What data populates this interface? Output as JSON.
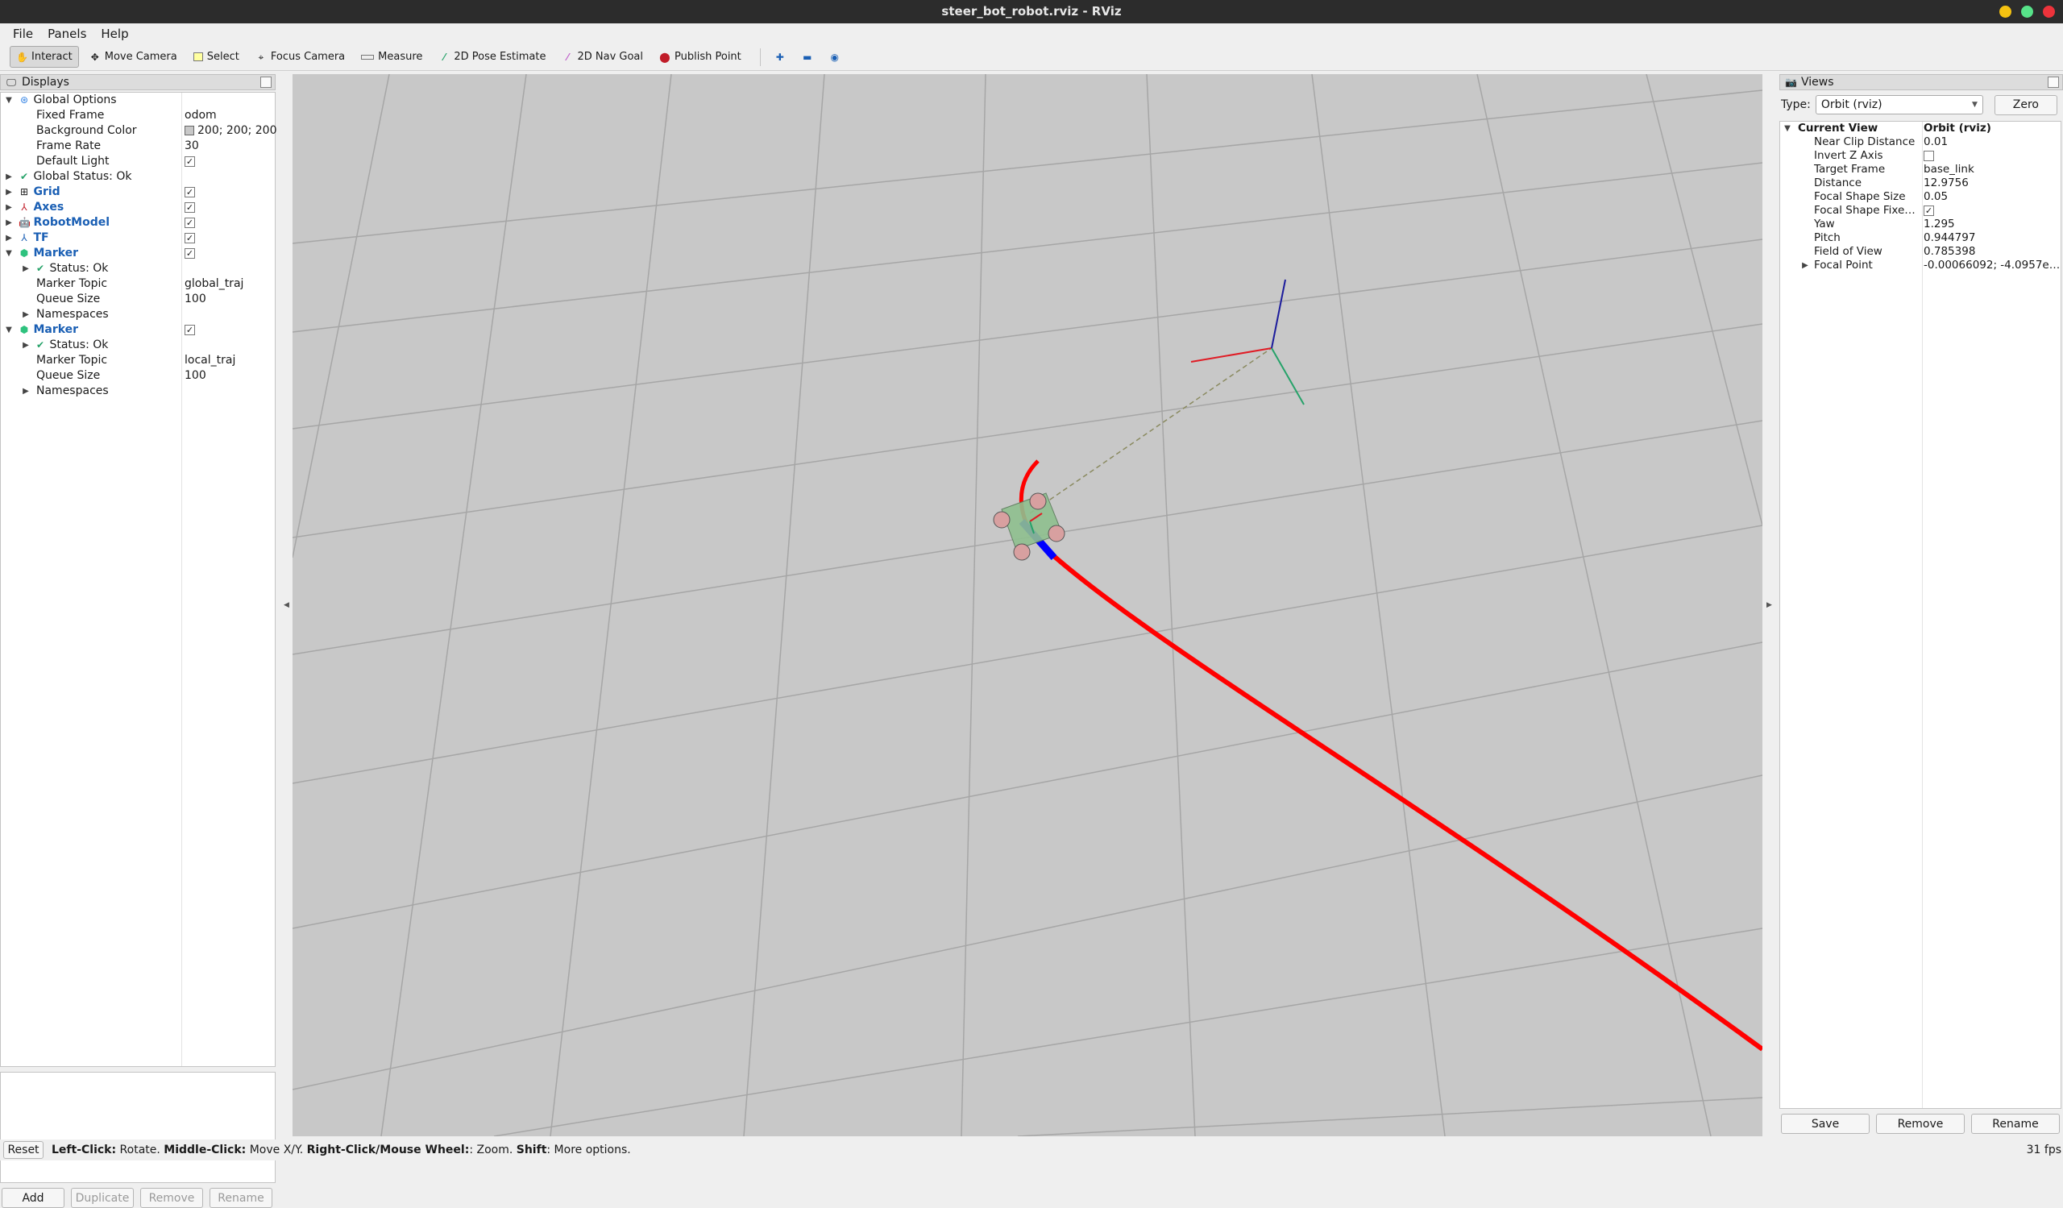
{
  "window": {
    "title": "steer_bot_robot.rviz - RViz",
    "controls": {
      "minimize": "#f5c211",
      "maximize": "#57e389",
      "close": "#ed333b"
    }
  },
  "menu": [
    "File",
    "Panels",
    "Help"
  ],
  "toolbar": {
    "tools": [
      {
        "label": "Interact",
        "icon": "hand-icon"
      },
      {
        "label": "Move Camera",
        "icon": "move-camera-icon"
      },
      {
        "label": "Select",
        "icon": "select-box-icon"
      },
      {
        "label": "Focus Camera",
        "icon": "focus-icon"
      },
      {
        "label": "Measure",
        "icon": "ruler-icon"
      },
      {
        "label": "2D Pose Estimate",
        "icon": "pose-arrow-icon"
      },
      {
        "label": "2D Nav Goal",
        "icon": "goal-arrow-icon"
      },
      {
        "label": "Publish Point",
        "icon": "pin-icon"
      }
    ],
    "extras": [
      {
        "icon": "add-tool-icon"
      },
      {
        "icon": "remove-tool-icon"
      },
      {
        "icon": "eye-icon"
      }
    ]
  },
  "displays": {
    "title": "Displays",
    "rows": [
      {
        "label": "Global Options",
        "kind": "group",
        "icon": "globe-icon",
        "arrow": "down"
      },
      {
        "label": "Fixed Frame",
        "value": "odom",
        "kind": "prop"
      },
      {
        "label": "Background Color",
        "value": "200; 200; 200",
        "kind": "prop-color"
      },
      {
        "label": "Frame Rate",
        "value": "30",
        "kind": "prop"
      },
      {
        "label": "Default Light",
        "kind": "prop-check",
        "checked": true
      },
      {
        "label": "Global Status: Ok",
        "kind": "status-top",
        "arrow": "right"
      },
      {
        "label": "Grid",
        "kind": "display",
        "icon": "grid-icon",
        "checked": true
      },
      {
        "label": "Axes",
        "kind": "display",
        "icon": "axes-icon",
        "checked": true
      },
      {
        "label": "RobotModel",
        "kind": "display",
        "icon": "robot-icon",
        "checked": true
      },
      {
        "label": "TF",
        "kind": "display",
        "icon": "tf-icon",
        "checked": true
      },
      {
        "label": "Marker",
        "kind": "display-open",
        "icon": "marker-icon",
        "checked": true
      },
      {
        "label": "Status: Ok",
        "kind": "status-sub",
        "arrow": "right"
      },
      {
        "label": "Marker Topic",
        "value": "global_traj",
        "kind": "prop"
      },
      {
        "label": "Queue Size",
        "value": "100",
        "kind": "prop"
      },
      {
        "label": "Namespaces",
        "kind": "prop-arrow",
        "arrow": "right"
      },
      {
        "label": "Marker",
        "kind": "display-open",
        "icon": "marker-icon",
        "checked": true
      },
      {
        "label": "Status: Ok",
        "kind": "status-sub",
        "arrow": "right"
      },
      {
        "label": "Marker Topic",
        "value": "local_traj",
        "kind": "prop"
      },
      {
        "label": "Queue Size",
        "value": "100",
        "kind": "prop"
      },
      {
        "label": "Namespaces",
        "kind": "prop-arrow",
        "arrow": "right"
      }
    ],
    "buttons": [
      {
        "label": "Add",
        "enabled": true
      },
      {
        "label": "Duplicate",
        "enabled": false
      },
      {
        "label": "Remove",
        "enabled": false
      },
      {
        "label": "Rename",
        "enabled": false
      }
    ]
  },
  "views": {
    "title": "Views",
    "type_label": "Type:",
    "type_value": "Orbit (rviz)",
    "zero_label": "Zero",
    "header": {
      "label": "Current View",
      "value": "Orbit (rviz)"
    },
    "rows": [
      {
        "label": "Near Clip Distance",
        "value": "0.01"
      },
      {
        "label": "Invert Z Axis",
        "check": false
      },
      {
        "label": "Target Frame",
        "value": "base_link"
      },
      {
        "label": "Distance",
        "value": "12.9756"
      },
      {
        "label": "Focal Shape Size",
        "value": "0.05"
      },
      {
        "label": "Focal Shape Fixe…",
        "check": true
      },
      {
        "label": "Yaw",
        "value": "1.295"
      },
      {
        "label": "Pitch",
        "value": "0.944797"
      },
      {
        "label": "Field of View",
        "value": "0.785398"
      },
      {
        "label": "Focal Point",
        "value": "-0.00066092; -4.0957e…",
        "arrow": true
      }
    ],
    "buttons": [
      "Save",
      "Remove",
      "Rename"
    ]
  },
  "status": {
    "reset_label": "Reset",
    "segments": [
      {
        "b": "Left-Click:",
        "t": " Rotate. "
      },
      {
        "b": "Middle-Click:",
        "t": " Move X/Y. "
      },
      {
        "b": "Right-Click/Mouse Wheel:",
        "t": ": Zoom. "
      },
      {
        "b": "Shift",
        "t": ": More options."
      }
    ],
    "fps": "31 fps"
  },
  "scene": {
    "background": "#c8c8c8",
    "grid_color": "#a0a0a0",
    "trajectory_color": "#ff0000",
    "local_traj_color": "#0000ff"
  }
}
